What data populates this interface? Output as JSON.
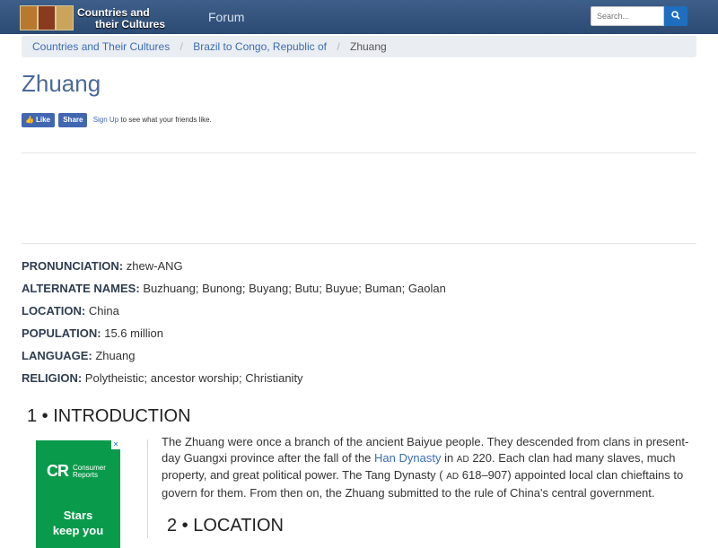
{
  "header": {
    "logo_line1": "Countries and",
    "logo_line2": "their Cultures",
    "nav_forum": "Forum",
    "search_placeholder": "Search...",
    "search_icon": "search-icon",
    "colors": {
      "bar": "#2f507a",
      "search_button": "#1f6fc0",
      "link": "#3b6cb3"
    }
  },
  "breadcrumb": {
    "items": [
      "Countries and Their Cultures",
      "Brazil to Congo, Republic of"
    ],
    "current": "Zhuang",
    "separator": "/"
  },
  "page_title": "Zhuang",
  "social": {
    "like": "Like",
    "share": "Share",
    "signup": "Sign Up",
    "rest": "to see what your friends like."
  },
  "facts": [
    {
      "label": "PRONUNCIATION:",
      "value": "zhew-ANG"
    },
    {
      "label": "ALTERNATE NAMES:",
      "value": "Buzhuang; Bunong; Buyang; Butu; Buyue; Buman; Gaolan"
    },
    {
      "label": "LOCATION:",
      "value": "China"
    },
    {
      "label": "POPULATION:",
      "value": "15.6 million"
    },
    {
      "label": "LANGUAGE:",
      "value": "Zhuang"
    },
    {
      "label": "RELIGION:",
      "value": "Polytheistic; ancestor worship; Christianity"
    }
  ],
  "sections": [
    {
      "title": "1 • INTRODUCTION"
    },
    {
      "title": "2 • LOCATION"
    }
  ],
  "intro": {
    "p1": "The Zhuang were once a branch of the ancient Baiyue people. They descended from clans in present-day Guangxi province after the fall of the ",
    "link": "Han Dynasty",
    "p2": " in ",
    "ad1": "AD",
    "p3": " 220. Each clan had many slaves, much property, and great political power. The Tang Dynasty ( ",
    "ad2": "AD",
    "p4": " 618–907) appointed local clan chieftains to govern for them. From then on, the Zhuang submitted to the rule of China's central government."
  },
  "ad": {
    "cr": "CR",
    "brand1": "Consumer",
    "brand2": "Reports",
    "line1": "Stars",
    "line2": "keep you",
    "close": "✕",
    "color": "#0a9a4b"
  }
}
